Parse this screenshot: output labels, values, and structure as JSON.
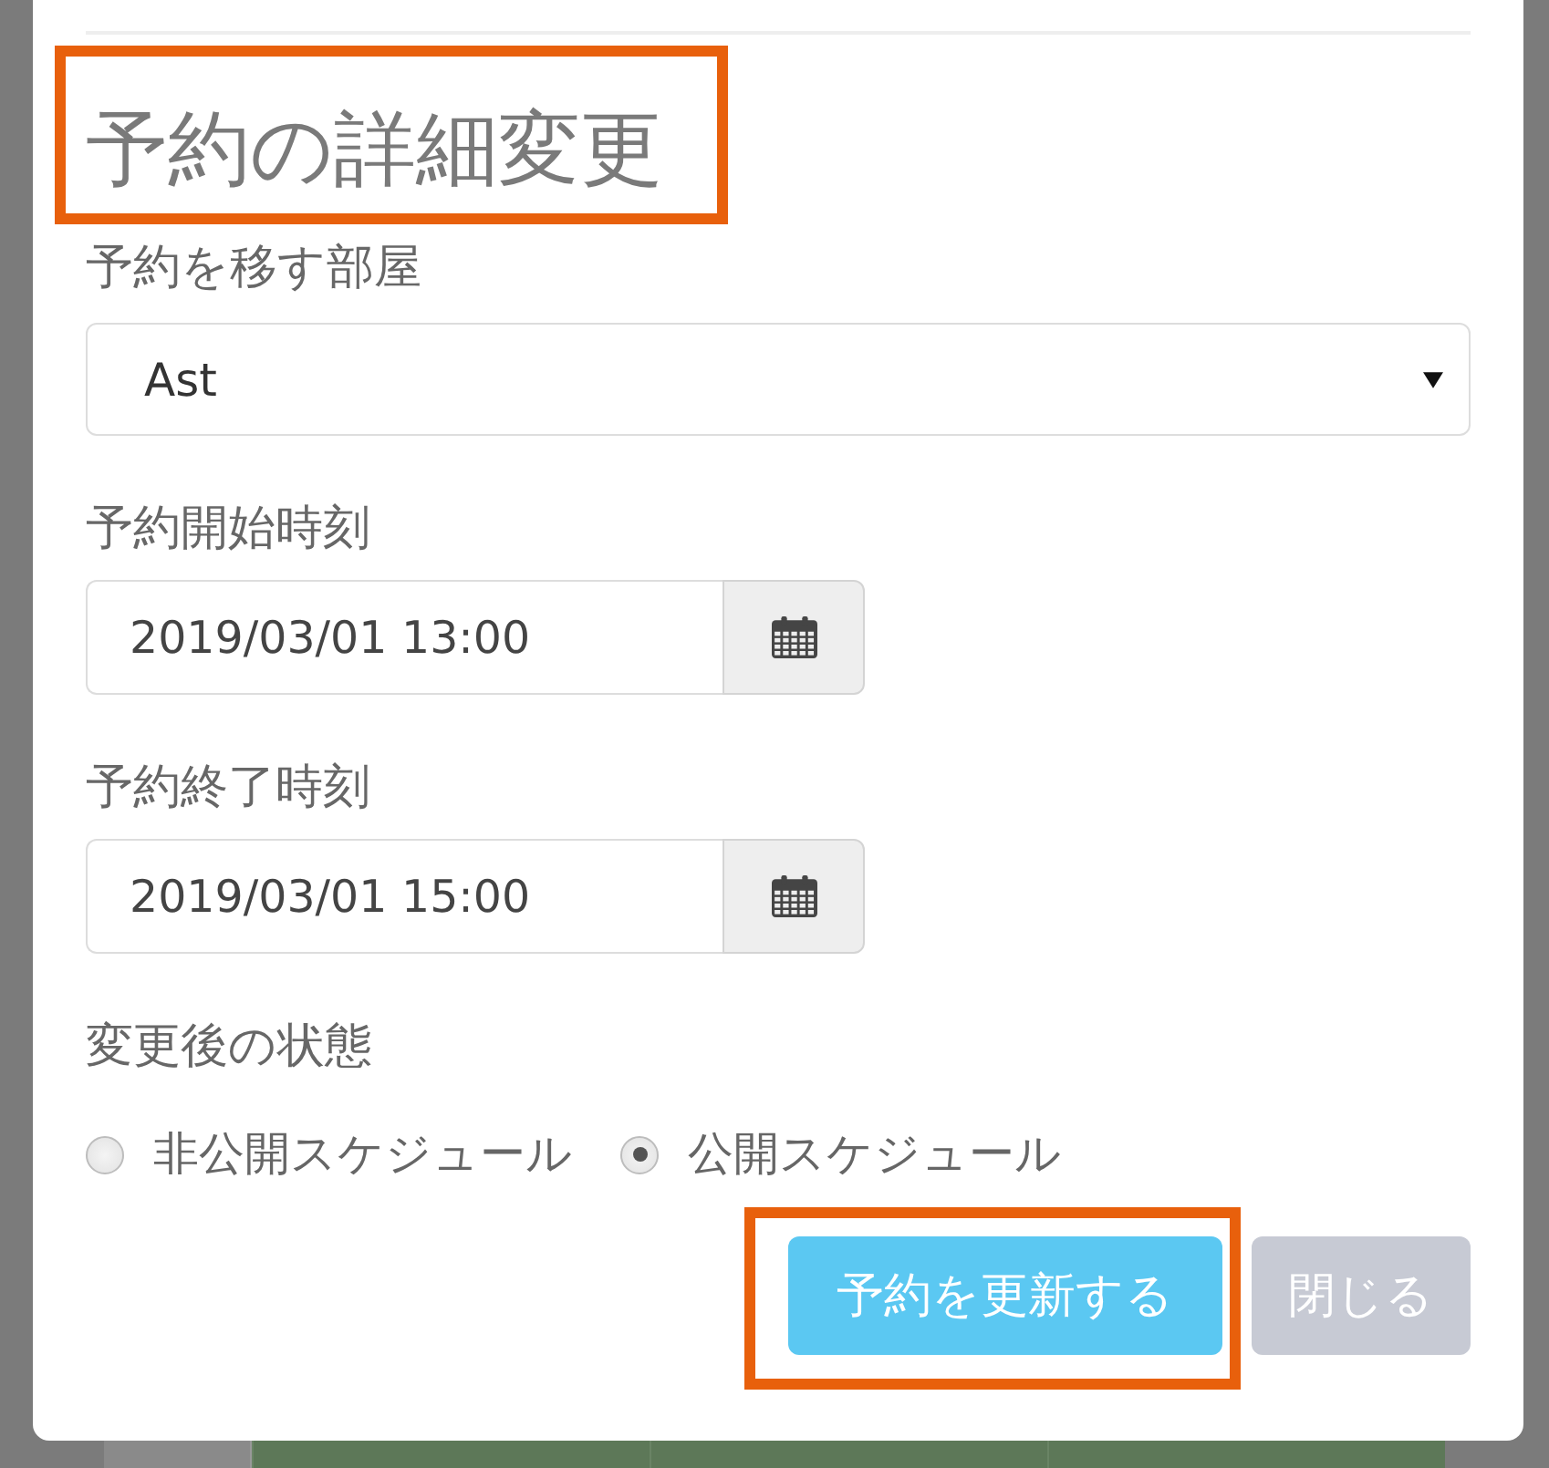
{
  "dialog": {
    "title": {
      "text": "予約の詳細変更",
      "highlighted": true
    },
    "fields": [
      {
        "kind": "select",
        "label": "予約を移す部屋",
        "value": "Ast"
      },
      {
        "kind": "datetime",
        "label": "予約開始時刻",
        "value": "2019/03/01 13:00"
      },
      {
        "kind": "datetime",
        "label": "予約終了時刻",
        "value": "2019/03/01 15:00"
      }
    ],
    "status": {
      "label": "変更後の状態",
      "options": [
        {
          "label": "非公開スケジュール",
          "selected": false
        },
        {
          "label": "公開スケジュール",
          "selected": true
        }
      ]
    },
    "buttons": [
      {
        "kind": "primary",
        "label": "予約を更新する",
        "highlighted": true
      },
      {
        "kind": "secondary",
        "label": "閉じる",
        "highlighted": false
      }
    ]
  }
}
